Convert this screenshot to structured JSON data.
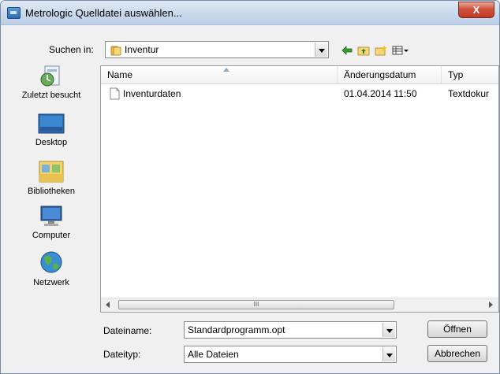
{
  "window": {
    "title": "Metrologic Quelldatei auswählen...",
    "close_glyph": "X"
  },
  "lookin": {
    "label": "Suchen in:",
    "value": "Inventur"
  },
  "toolbar": {
    "icons": [
      "back-arrow-icon",
      "up-folder-icon",
      "new-folder-icon",
      "view-menu-icon"
    ]
  },
  "places": [
    {
      "label": "Zuletzt besucht",
      "icon": "recent-places-icon"
    },
    {
      "label": "Desktop",
      "icon": "desktop-icon"
    },
    {
      "label": "Bibliotheken",
      "icon": "libraries-icon"
    },
    {
      "label": "Computer",
      "icon": "computer-icon"
    },
    {
      "label": "Netzwerk",
      "icon": "network-icon"
    }
  ],
  "filelist": {
    "columns": [
      "Name",
      "Änderungsdatum",
      "Typ"
    ],
    "rows": [
      {
        "name": "Inventurdaten",
        "date": "01.04.2014 11:50",
        "type": "Textdokur"
      }
    ],
    "scroll_grip": "III"
  },
  "filename": {
    "label": "Dateiname:",
    "value": "Standardprogramm.opt"
  },
  "filetype": {
    "label": "Dateityp:",
    "value": "Alle Dateien"
  },
  "buttons": {
    "open": "Öffnen",
    "cancel": "Abbrechen"
  }
}
